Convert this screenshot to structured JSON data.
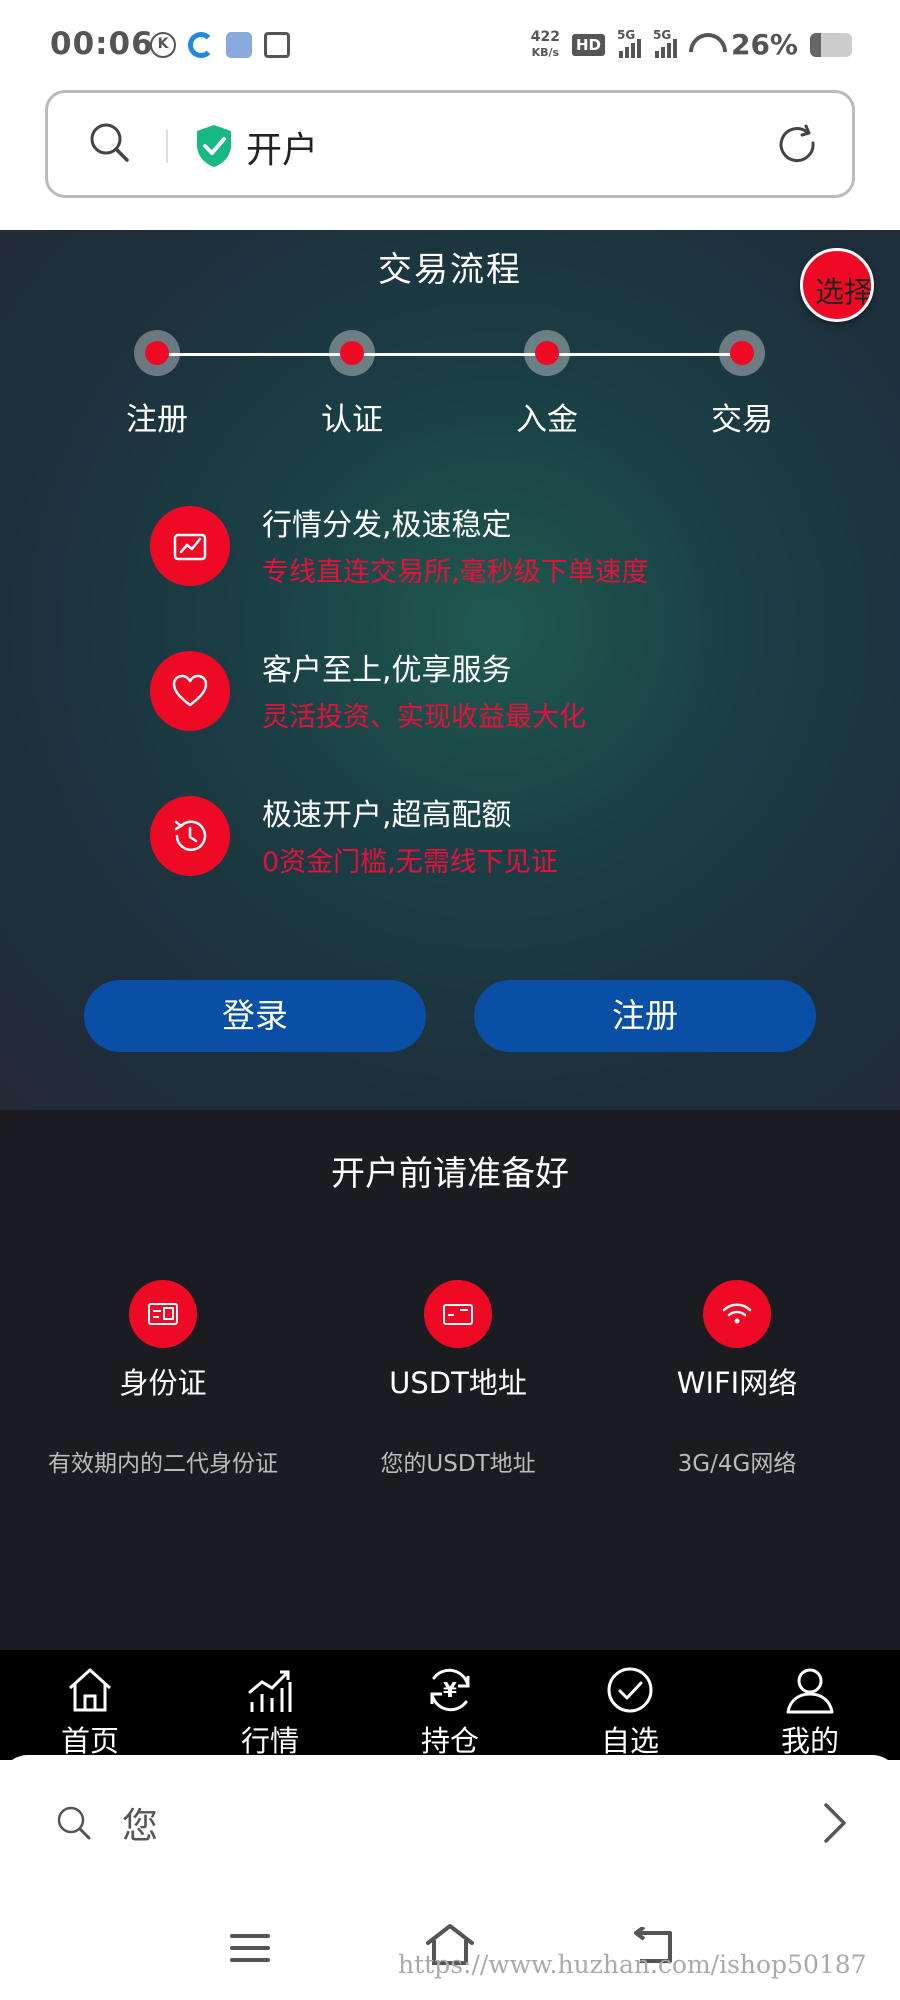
{
  "status_bar": {
    "time": "00:06",
    "net_speed_value": "422",
    "net_speed_unit": "KB/s",
    "hd_label": "HD",
    "signal_1_label": "5G",
    "signal_2_label": "5G",
    "battery_percent": "26%",
    "battery_level": 0.26
  },
  "url_bar": {
    "title": "开户",
    "icons": [
      "search-icon",
      "shield-check-icon",
      "refresh-icon"
    ]
  },
  "hero": {
    "title": "交易流程",
    "language_button": "选择语言",
    "steps": [
      "注册",
      "认证",
      "入金",
      "交易"
    ],
    "features": [
      {
        "title": "行情分发,极速稳定",
        "subtitle": "专线直连交易所,毫秒级下单速度",
        "icon": "chart-card-icon"
      },
      {
        "title": "客户至上,优享服务",
        "subtitle": "灵活投资、实现收益最大化",
        "icon": "heart-icon"
      },
      {
        "title": "极速开户,超高配额",
        "subtitle": "0资金门槛,无需线下见证",
        "icon": "history-clock-icon"
      }
    ],
    "login_label": "登录",
    "register_label": "注册",
    "accent_color": "#ee0a24",
    "button_color": "#0a4fa6"
  },
  "prep": {
    "title": "开户前请准备好",
    "items": [
      {
        "name": "身份证",
        "desc": "有效期内的二代身份证",
        "icon": "id-card-icon"
      },
      {
        "name": "USDT地址",
        "desc": "您的USDT地址",
        "icon": "wallet-card-icon"
      },
      {
        "name": "WIFI网络",
        "desc": "3G/4G网络",
        "icon": "wifi-icon"
      }
    ]
  },
  "bottom_nav": {
    "items": [
      {
        "label": "首页",
        "icon": "home-icon"
      },
      {
        "label": "行情",
        "icon": "market-chart-icon"
      },
      {
        "label": "持仓",
        "icon": "yen-refresh-icon"
      },
      {
        "label": "自选",
        "icon": "check-circle-icon"
      },
      {
        "label": "我的",
        "icon": "user-icon"
      }
    ]
  },
  "bottom_sheet": {
    "search_text": "您"
  },
  "watermark": "https://www.huzhan.com/ishop50187"
}
